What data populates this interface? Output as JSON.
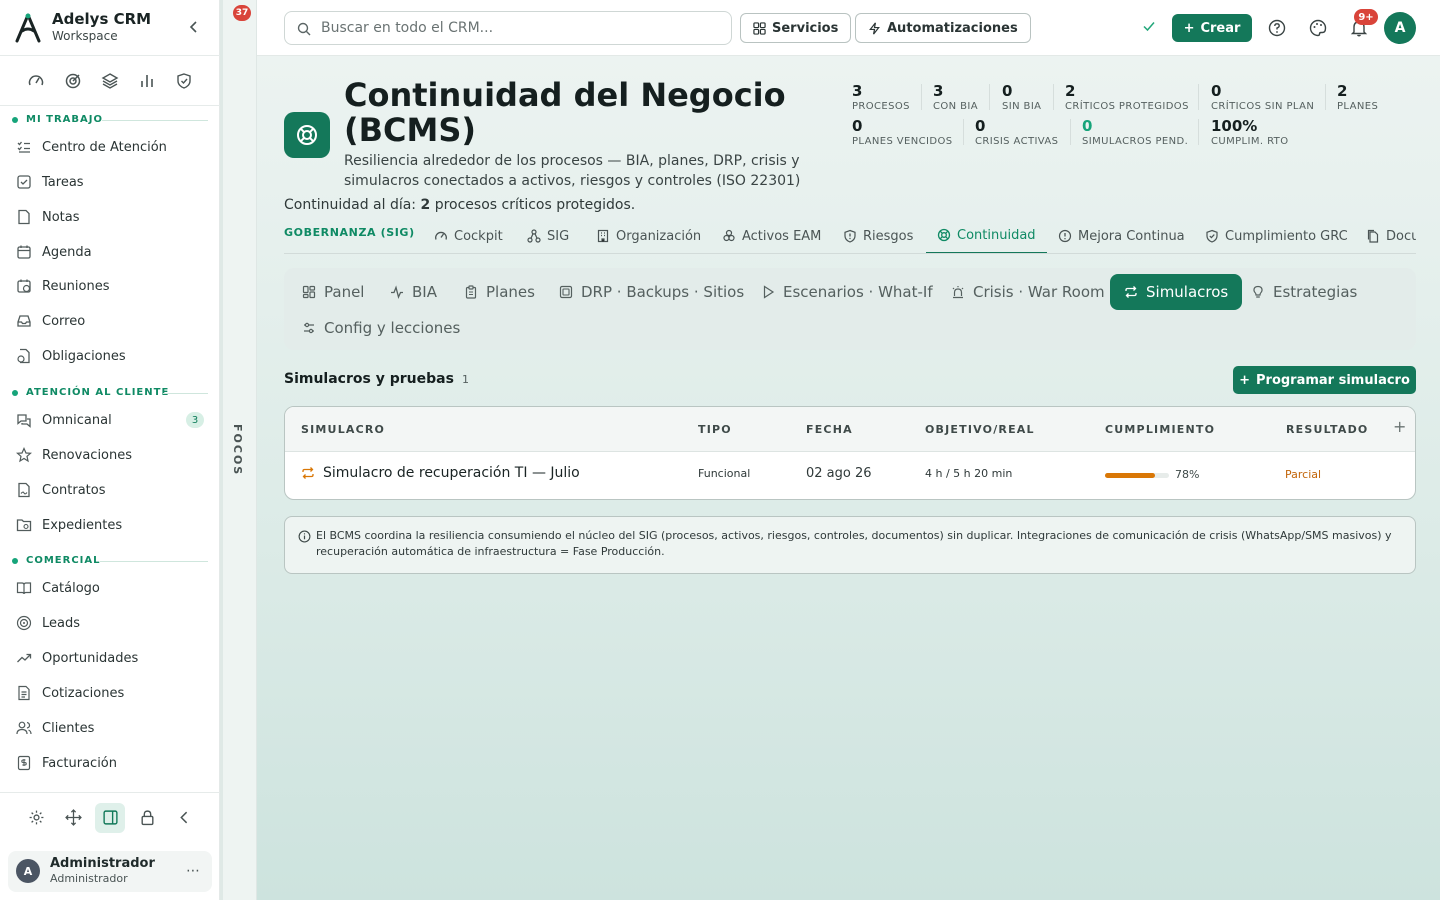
{
  "brand": {
    "name": "Adelys CRM",
    "subtitle": "Workspace"
  },
  "sidebar": {
    "sections": [
      {
        "label": "MI TRABAJO"
      },
      {
        "label": "ATENCIÓN AL CLIENTE"
      },
      {
        "label": "COMERCIAL"
      }
    ],
    "items": [
      {
        "label": "Centro de Atención",
        "icon": "list-check-icon"
      },
      {
        "label": "Tareas",
        "icon": "checkbox-icon"
      },
      {
        "label": "Notas",
        "icon": "note-icon"
      },
      {
        "label": "Agenda",
        "icon": "calendar-icon"
      },
      {
        "label": "Reuniones",
        "icon": "calendar-clock-icon"
      },
      {
        "label": "Correo",
        "icon": "inbox-icon"
      },
      {
        "label": "Obligaciones",
        "icon": "file-clock-icon"
      },
      {
        "label": "Omnicanal",
        "icon": "chat-icon",
        "badge": "3"
      },
      {
        "label": "Renovaciones",
        "icon": "star-icon"
      },
      {
        "label": "Contratos",
        "icon": "file-sign-icon"
      },
      {
        "label": "Expedientes",
        "icon": "folder-search-icon"
      },
      {
        "label": "Catálogo",
        "icon": "book-icon"
      },
      {
        "label": "Leads",
        "icon": "target-icon"
      },
      {
        "label": "Oportunidades",
        "icon": "trend-up-icon"
      },
      {
        "label": "Cotizaciones",
        "icon": "document-icon"
      },
      {
        "label": "Clientes",
        "icon": "users-icon"
      },
      {
        "label": "Facturación",
        "icon": "receipt-icon"
      }
    ]
  },
  "user": {
    "initial": "A",
    "name": "Administrador",
    "role": "Administrador"
  },
  "focos": {
    "label": "FOCOS",
    "badge": "37"
  },
  "topbar": {
    "search_placeholder": "Buscar en todo el CRM...",
    "services_label": "Servicios",
    "automations_label": "Automatizaciones",
    "create_label": "Crear",
    "notifications_badge": "9+",
    "avatar_initial": "A"
  },
  "header": {
    "title": "Continuidad del Negocio (BCMS)",
    "subtitle": "Resiliencia alrededor de los procesos — BIA, planes, DRP, crisis y simulacros conectados a activos, riesgos y controles (ISO 22301)",
    "continuity_prefix": "Continuidad al día:",
    "continuity_count": "2",
    "continuity_suffix": "procesos críticos protegidos."
  },
  "kpis": [
    {
      "value": "3",
      "label": "PROCESOS"
    },
    {
      "value": "3",
      "label": "CON BIA"
    },
    {
      "value": "0",
      "label": "SIN BIA"
    },
    {
      "value": "2",
      "label": "CRÍTICOS PROTEGIDOS"
    },
    {
      "value": "0",
      "label": "CRÍTICOS SIN PLAN"
    },
    {
      "value": "2",
      "label": "PLANES"
    },
    {
      "value": "0",
      "label": "PLANES VENCIDOS"
    },
    {
      "value": "0",
      "label": "CRISIS ACTIVAS"
    },
    {
      "value": "0",
      "label": "SIMULACROS PEND."
    },
    {
      "value": "100%",
      "label": "CUMPLIM. RTO"
    }
  ],
  "module_tabs": {
    "section_label": "GOBERNANZA (SIG)",
    "tabs": [
      {
        "label": "Cockpit",
        "icon": "gauge-icon"
      },
      {
        "label": "SIG",
        "icon": "network-icon"
      },
      {
        "label": "Organización",
        "icon": "building-icon"
      },
      {
        "label": "Activos EAM",
        "icon": "cogs-icon"
      },
      {
        "label": "Riesgos",
        "icon": "shield-alert-icon"
      },
      {
        "label": "Continuidad",
        "icon": "life-buoy-icon",
        "active": true
      },
      {
        "label": "Mejora Continua",
        "icon": "alert-circle-icon"
      },
      {
        "label": "Cumplimiento GRC",
        "icon": "shield-check-icon"
      },
      {
        "label": "Docu",
        "icon": "documents-icon"
      }
    ]
  },
  "sub_tabs": [
    {
      "label": "Panel",
      "icon": "grid-icon"
    },
    {
      "label": "BIA",
      "icon": "activity-icon"
    },
    {
      "label": "Planes",
      "icon": "clipboard-icon"
    },
    {
      "label": "DRP · Backups · Sitios",
      "icon": "server-icon"
    },
    {
      "label": "Escenarios · What-If",
      "icon": "play-icon"
    },
    {
      "label": "Crisis · War Room",
      "icon": "siren-icon"
    },
    {
      "label": "Simulacros",
      "icon": "repeat-icon",
      "active": true
    },
    {
      "label": "Estrategias",
      "icon": "lightbulb-icon"
    },
    {
      "label": "Config y lecciones",
      "icon": "sliders-icon"
    }
  ],
  "section": {
    "title": "Simulacros y pruebas",
    "count": "1",
    "action_label": "Programar simulacro"
  },
  "table": {
    "columns": [
      "SIMULACRO",
      "TIPO",
      "FECHA",
      "OBJETIVO/REAL",
      "CUMPLIMIENTO",
      "RESULTADO"
    ],
    "rows": [
      {
        "name": "Simulacro de recuperación TI — Julio",
        "type": "Funcional",
        "date": "02 ago 26",
        "target_real": "4 h / 5 h 20 min",
        "compliance": 78,
        "compliance_label": "78%",
        "result": "Parcial"
      }
    ]
  },
  "info_note": "El BCMS coordina la resiliencia consumiendo el núcleo del SIG (procesos, activos, riesgos, controles, documentos) sin duplicar. Integraciones de comunicación de crisis (WhatsApp/SMS masivos) y recuperación automática de infraestructura = Fase Producción.",
  "colors": {
    "accent": "#14785a",
    "accent_text": "#0f8a64",
    "badge_red": "#d9443a",
    "warning": "#d97706"
  }
}
